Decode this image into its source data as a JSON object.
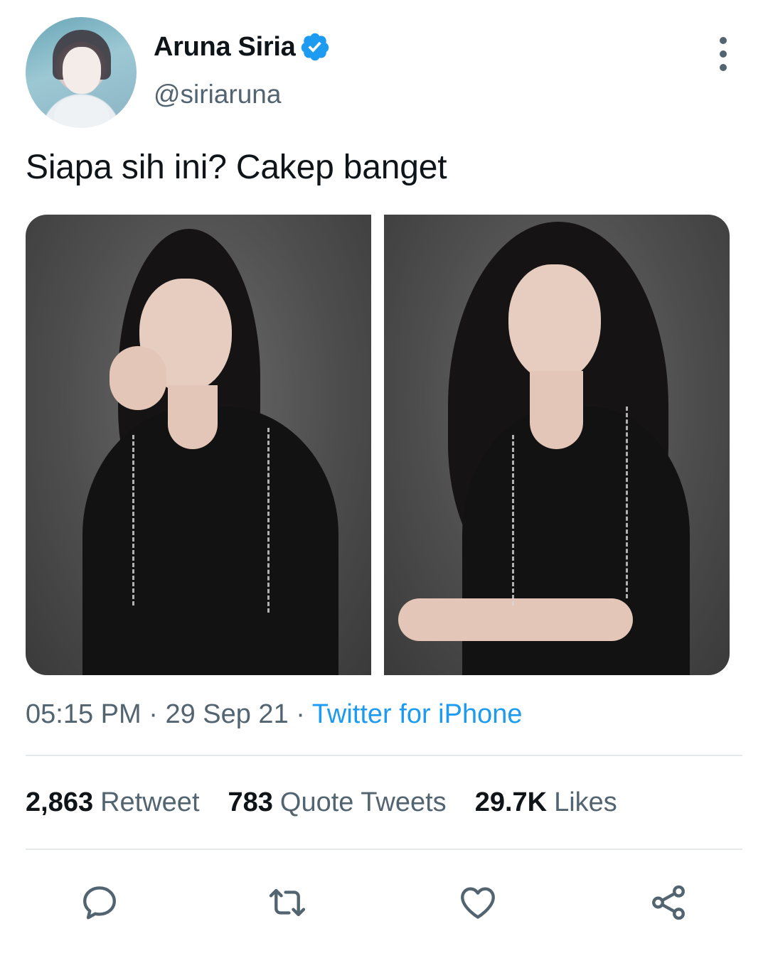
{
  "author": {
    "name": "Aruna Siria",
    "handle": "@siriaruna",
    "verified": true
  },
  "tweet": {
    "text": "Siapa sih ini? Cakep banget",
    "media_count": 2
  },
  "meta": {
    "time": "05:15 PM",
    "separator": " · ",
    "date": "29 Sep 21",
    "separator2": " · ",
    "source": "Twitter for iPhone"
  },
  "stats": [
    {
      "count": "2,863",
      "label": "Retweet"
    },
    {
      "count": "783",
      "label": "Quote Tweets"
    },
    {
      "count": "29.7K",
      "label": "Likes"
    }
  ],
  "actions": {
    "reply": "reply-icon",
    "retweet": "retweet-icon",
    "like": "heart-icon",
    "share": "share-icon"
  },
  "colors": {
    "accent": "#1d9bf0",
    "secondary_text": "#536471",
    "primary_text": "#0f1419"
  }
}
